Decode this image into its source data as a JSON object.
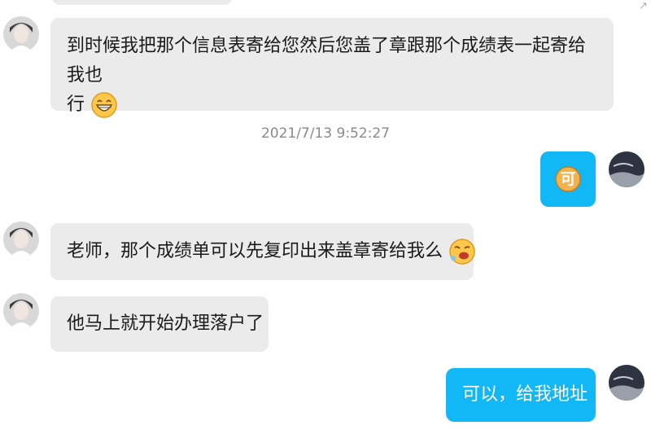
{
  "messages": [
    {
      "text1": "到时候我把那个信息表寄给您然后您盖了章跟那个成绩表一起寄给我也",
      "text2": "行",
      "emoji": "grinning-face-icon"
    },
    {
      "timestamp": "2021/7/13 9:52:27"
    },
    {
      "text": "可",
      "emoji": "ok-badge-icon"
    },
    {
      "text": "老师，那个成绩单可以先复印出来盖章寄给我么",
      "emoji": "crying-laughing-face-icon"
    },
    {
      "text": "他马上就开始办理落户了"
    },
    {
      "text": "可以，给我地址"
    }
  ],
  "colors": {
    "incoming_bubble": "#ebebeb",
    "outgoing_bubble": "#12b7f5",
    "timestamp": "#8a8a8a"
  }
}
